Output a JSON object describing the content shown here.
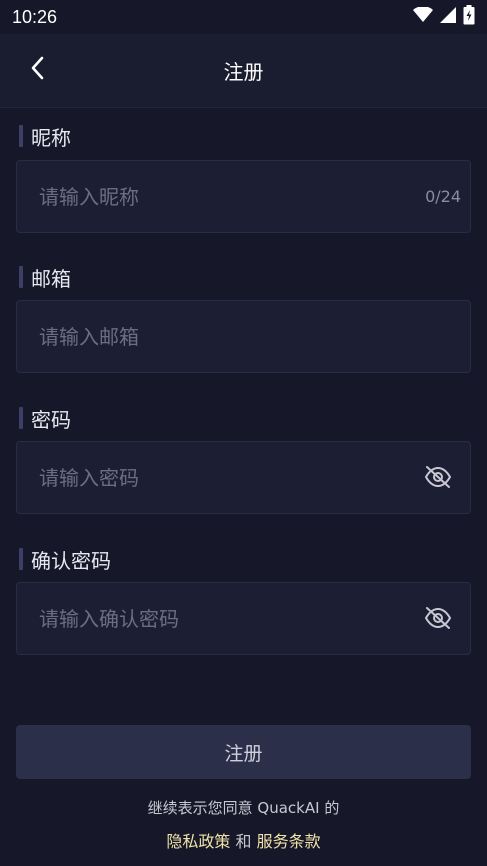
{
  "status_bar": {
    "time": "10:26",
    "icons": [
      "wifi-icon",
      "signal-icon",
      "battery-charging-icon"
    ]
  },
  "header": {
    "title": "注册",
    "back_icon": "chevron-left-icon"
  },
  "fields": {
    "nickname": {
      "label": "昵称",
      "placeholder": "请输入昵称",
      "counter": "0/24"
    },
    "email": {
      "label": "邮箱",
      "placeholder": "请输入邮箱"
    },
    "password": {
      "label": "密码",
      "placeholder": "请输入密码",
      "toggle_icon": "eye-off-icon"
    },
    "confirm_password": {
      "label": "确认密码",
      "placeholder": "请输入确认密码",
      "toggle_icon": "eye-off-icon"
    }
  },
  "submit_label": "注册",
  "agreement": {
    "prefix": "继续表示您同意 QuackAI 的",
    "privacy_link": "隐私政策",
    "conjunction": " 和 ",
    "terms_link": "服务条款"
  },
  "colors": {
    "background": "#161729",
    "header_background": "#1a1c30",
    "input_background": "#1c1e33",
    "button_background": "#2c2f4a",
    "link": "#f0e3a8",
    "label_bar": "#3c4066"
  }
}
